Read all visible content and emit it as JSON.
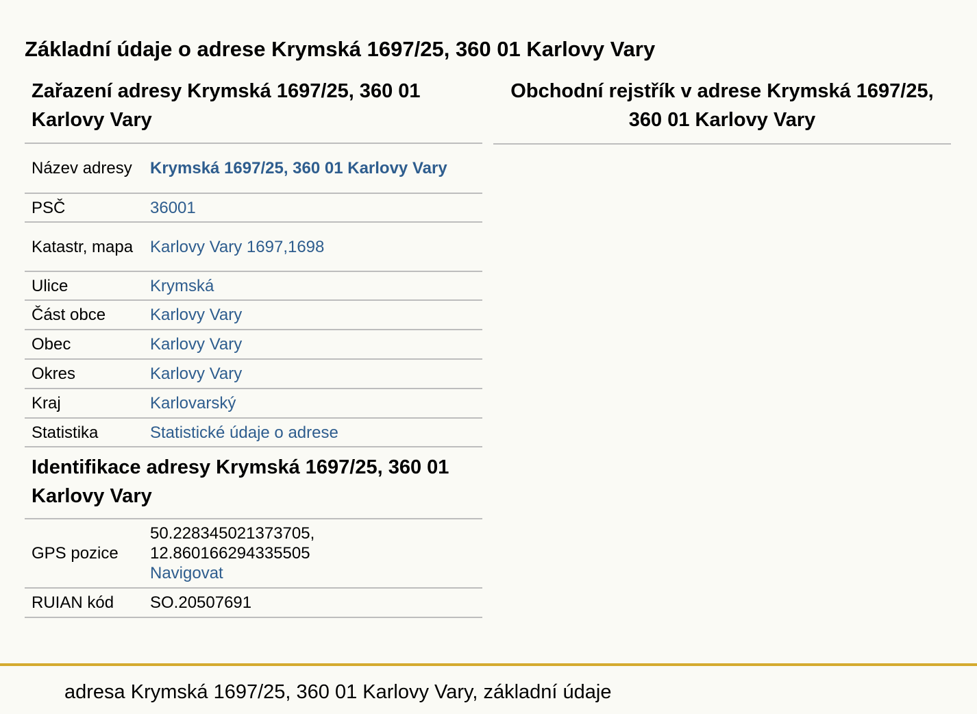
{
  "page": {
    "title": "Základní údaje o adrese Krymská 1697/25, 360 01 Karlovy Vary"
  },
  "zarazeni": {
    "heading": "Zařazení adresy Krymská 1697/25, 360 01 Karlovy Vary",
    "rows": [
      {
        "label": "Název adresy",
        "value": "Krymská 1697/25, 360 01 Karlovy Vary"
      },
      {
        "label": "PSČ",
        "value": "36001"
      },
      {
        "label": "Katastr, mapa",
        "value": "Karlovy Vary 1697,1698"
      },
      {
        "label": "Ulice",
        "value": "Krymská"
      },
      {
        "label": "Část obce",
        "value": "Karlovy Vary"
      },
      {
        "label": "Obec",
        "value": "Karlovy Vary"
      },
      {
        "label": "Okres",
        "value": "Karlovy Vary"
      },
      {
        "label": "Kraj",
        "value": "Karlovarský"
      },
      {
        "label": "Statistika",
        "value": "Statistické údaje o adrese"
      }
    ]
  },
  "identifikace": {
    "heading": "Identifikace adresy Krymská 1697/25, 360 01 Karlovy Vary",
    "gps": {
      "label": "GPS pozice",
      "lat": "50.228345021373705,",
      "lon": "12.860166294335505",
      "nav_link": "Navigovat"
    },
    "ruian": {
      "label": "RUIAN kód",
      "value": "SO.20507691"
    }
  },
  "obchodni": {
    "heading": "Obchodní rejstřík v adrese Krymská 1697/25, 360 01 Karlovy Vary"
  },
  "footer": {
    "text": "adresa Krymská 1697/25, 360 01 Karlovy Vary, základní údaje"
  },
  "colors": {
    "link": "#2e5d8e",
    "footer_accent": "#d4aa2f",
    "background": "#fafaf5"
  }
}
